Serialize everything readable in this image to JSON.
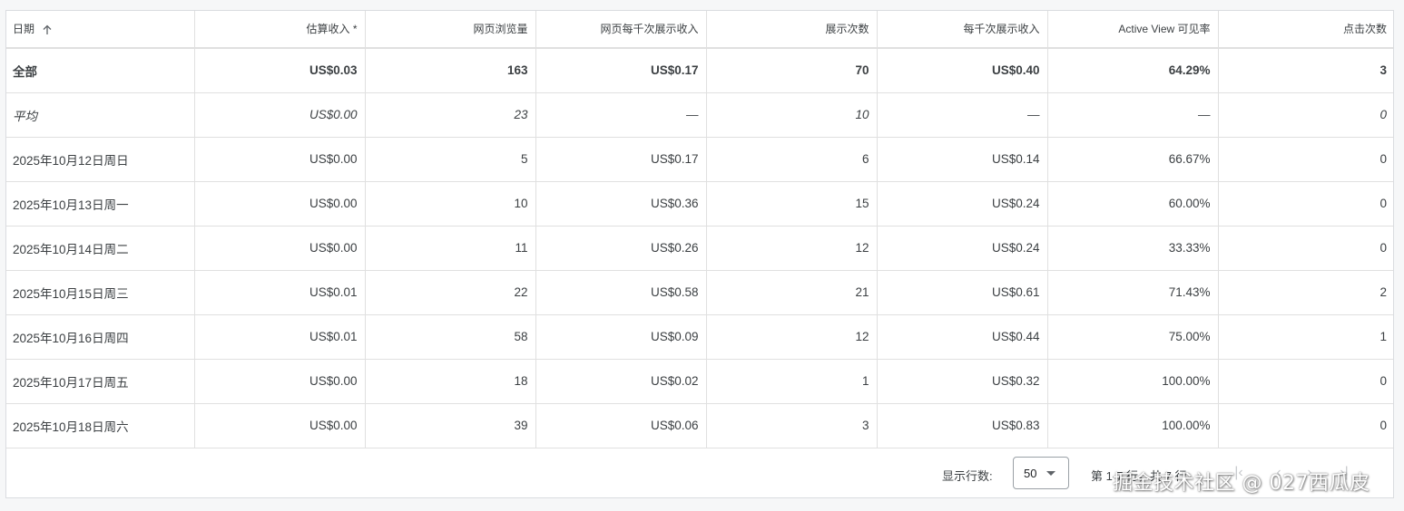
{
  "table": {
    "columns": [
      {
        "label": "日期",
        "sortable": true,
        "sorted": "ascending"
      },
      {
        "label": "估算收入 *"
      },
      {
        "label": "网页浏览量"
      },
      {
        "label": "网页每千次展示收入"
      },
      {
        "label": "展示次数"
      },
      {
        "label": "每千次展示收入"
      },
      {
        "label": "Active View 可见率"
      },
      {
        "label": "点击次数"
      }
    ],
    "total": [
      "全部",
      "US$0.03",
      "163",
      "US$0.17",
      "70",
      "US$0.40",
      "64.29%",
      "3"
    ],
    "average": [
      "平均",
      "US$0.00",
      "23",
      "—",
      "10",
      "—",
      "—",
      "0"
    ],
    "rows": [
      [
        "2025年10月12日周日",
        "US$0.00",
        "5",
        "US$0.17",
        "6",
        "US$0.14",
        "66.67%",
        "0"
      ],
      [
        "2025年10月13日周一",
        "US$0.00",
        "10",
        "US$0.36",
        "15",
        "US$0.24",
        "60.00%",
        "0"
      ],
      [
        "2025年10月14日周二",
        "US$0.00",
        "11",
        "US$0.26",
        "12",
        "US$0.24",
        "33.33%",
        "0"
      ],
      [
        "2025年10月15日周三",
        "US$0.01",
        "22",
        "US$0.58",
        "21",
        "US$0.61",
        "71.43%",
        "2"
      ],
      [
        "2025年10月16日周四",
        "US$0.01",
        "58",
        "US$0.09",
        "12",
        "US$0.44",
        "75.00%",
        "1"
      ],
      [
        "2025年10月17日周五",
        "US$0.00",
        "18",
        "US$0.02",
        "1",
        "US$0.32",
        "100.00%",
        "0"
      ],
      [
        "2025年10月18日周六",
        "US$0.00",
        "39",
        "US$0.06",
        "3",
        "US$0.83",
        "100.00%",
        "0"
      ]
    ]
  },
  "footer": {
    "rows_per_page_label": "显示行数:",
    "rows_per_page_value": "50",
    "page_info": "第 1-7 行，共 7 行",
    "icons": {
      "first_page": "first-page-icon",
      "prev_page": "chevron-left-icon",
      "next_page": "chevron-right-icon",
      "last_page": "last-page-icon"
    }
  },
  "watermark": "掘金技术社区 @ 027西瓜皮",
  "colors": {
    "border": "#e0e0e0",
    "text": "#3c4043",
    "pager_disabled": "#c8cacd"
  }
}
